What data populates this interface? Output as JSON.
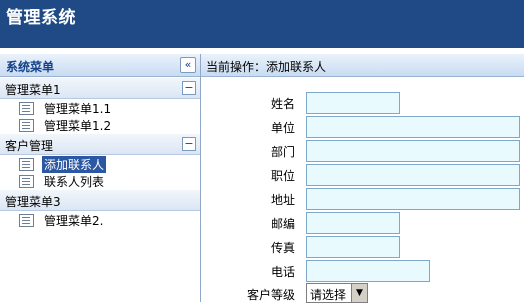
{
  "app": {
    "title": "管理系统"
  },
  "sidebar": {
    "title": "系统菜单",
    "collapse_glyph": "«",
    "groups": [
      {
        "label": "管理菜单1",
        "toggle": "−",
        "items": [
          {
            "label": "管理菜单1.1"
          },
          {
            "label": "管理菜单1.2"
          }
        ]
      },
      {
        "label": "客户管理",
        "toggle": "−",
        "items": [
          {
            "label": "添加联系人",
            "selected": true
          },
          {
            "label": "联系人列表"
          }
        ]
      },
      {
        "label": "管理菜单3",
        "items": [
          {
            "label": "管理菜单2."
          }
        ]
      }
    ]
  },
  "main": {
    "breadcrumb": "当前操作：添加联系人",
    "form": {
      "name": {
        "label": "姓名",
        "value": ""
      },
      "company": {
        "label": "单位",
        "value": ""
      },
      "department": {
        "label": "部门",
        "value": ""
      },
      "position": {
        "label": "职位",
        "value": ""
      },
      "address": {
        "label": "地址",
        "value": ""
      },
      "postcode": {
        "label": "邮编",
        "value": ""
      },
      "fax": {
        "label": "传真",
        "value": ""
      },
      "phone": {
        "label": "电话",
        "value": ""
      },
      "level": {
        "label": "客户等级",
        "selected": "请选择"
      }
    }
  },
  "colors": {
    "header_bg": "#1f4a86",
    "field_bg": "#e8fafd",
    "selected_bg": "#2b57a3"
  },
  "icons": {
    "menu_item": "list-page-icon"
  }
}
